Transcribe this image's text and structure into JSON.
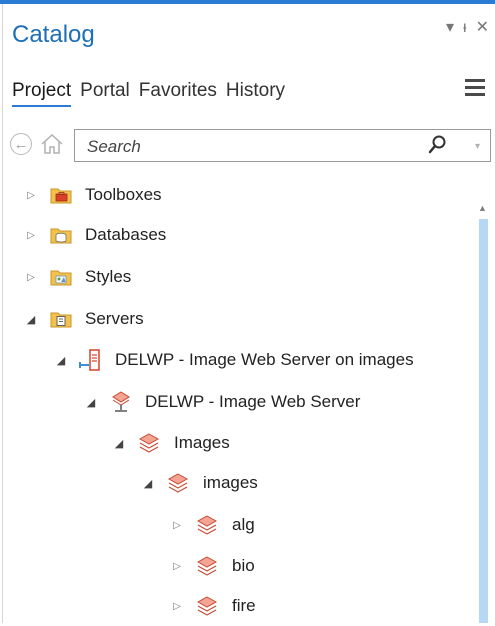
{
  "pane": {
    "title": "Catalog",
    "controls": {
      "dropdown": "▾",
      "pin": "ᵻ",
      "close": "✕"
    }
  },
  "tabs": [
    {
      "label": "Project",
      "active": true
    },
    {
      "label": "Portal"
    },
    {
      "label": "Favorites"
    },
    {
      "label": "History"
    }
  ],
  "nav": {
    "back_glyph": "←"
  },
  "search": {
    "placeholder": "Search",
    "dropdown_glyph": "▾"
  },
  "tree": [
    {
      "label": "Toolboxes",
      "expanded": false,
      "icon": "toolbox-icon"
    },
    {
      "label": "Databases",
      "expanded": false,
      "icon": "database-folder-icon"
    },
    {
      "label": "Styles",
      "expanded": false,
      "icon": "styles-folder-icon"
    },
    {
      "label": "Servers",
      "expanded": true,
      "icon": "server-folder-icon"
    },
    {
      "label": "DELWP - Image Web Server on images",
      "expanded": true,
      "icon": "server-connection-icon"
    },
    {
      "label": "DELWP - Image Web Server",
      "expanded": true,
      "icon": "image-server-icon"
    },
    {
      "label": "Images",
      "expanded": true,
      "icon": "image-service-folder-icon"
    },
    {
      "label": "images",
      "expanded": true,
      "icon": "image-service-folder-icon"
    },
    {
      "label": "alg",
      "expanded": false,
      "icon": "image-service-folder-icon"
    },
    {
      "label": "bio",
      "expanded": false,
      "icon": "image-service-folder-icon"
    },
    {
      "label": "fire",
      "expanded": false,
      "icon": "image-service-folder-icon"
    }
  ],
  "colors": {
    "accent": "#2a7cd3",
    "title": "#1d6fb8",
    "scrollbar": "#b5d9f3"
  }
}
